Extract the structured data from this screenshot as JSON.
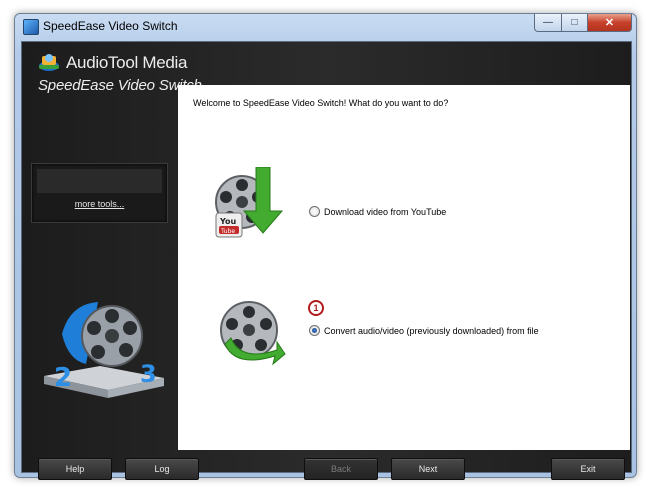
{
  "window": {
    "title": "SpeedEase Video Switch"
  },
  "titlebar_buttons": {
    "minimize": "—",
    "maximize": "□",
    "close": "✕"
  },
  "sidebar": {
    "brand": "AudioTool Media",
    "product": "SpeedEase Video Switch",
    "more_tools": "more tools..."
  },
  "main": {
    "welcome": "Welcome to SpeedEase Video Switch! What do you want to do?",
    "options": [
      {
        "label": "Download video from YouTube",
        "selected": false,
        "icon": "youtube-download-icon"
      },
      {
        "label": "Convert audio/video (previously downloaded) from file",
        "selected": true,
        "icon": "convert-file-icon"
      }
    ],
    "annotation": "1"
  },
  "buttons": {
    "help": "Help",
    "log": "Log",
    "back": "Back",
    "next": "Next",
    "exit": "Exit"
  },
  "colors": {
    "sidebar_bg": "#2b2b2b",
    "button_bg": "#3a3a3a",
    "annotation_red": "#b31b1b",
    "accent_green": "#3aa13a"
  }
}
